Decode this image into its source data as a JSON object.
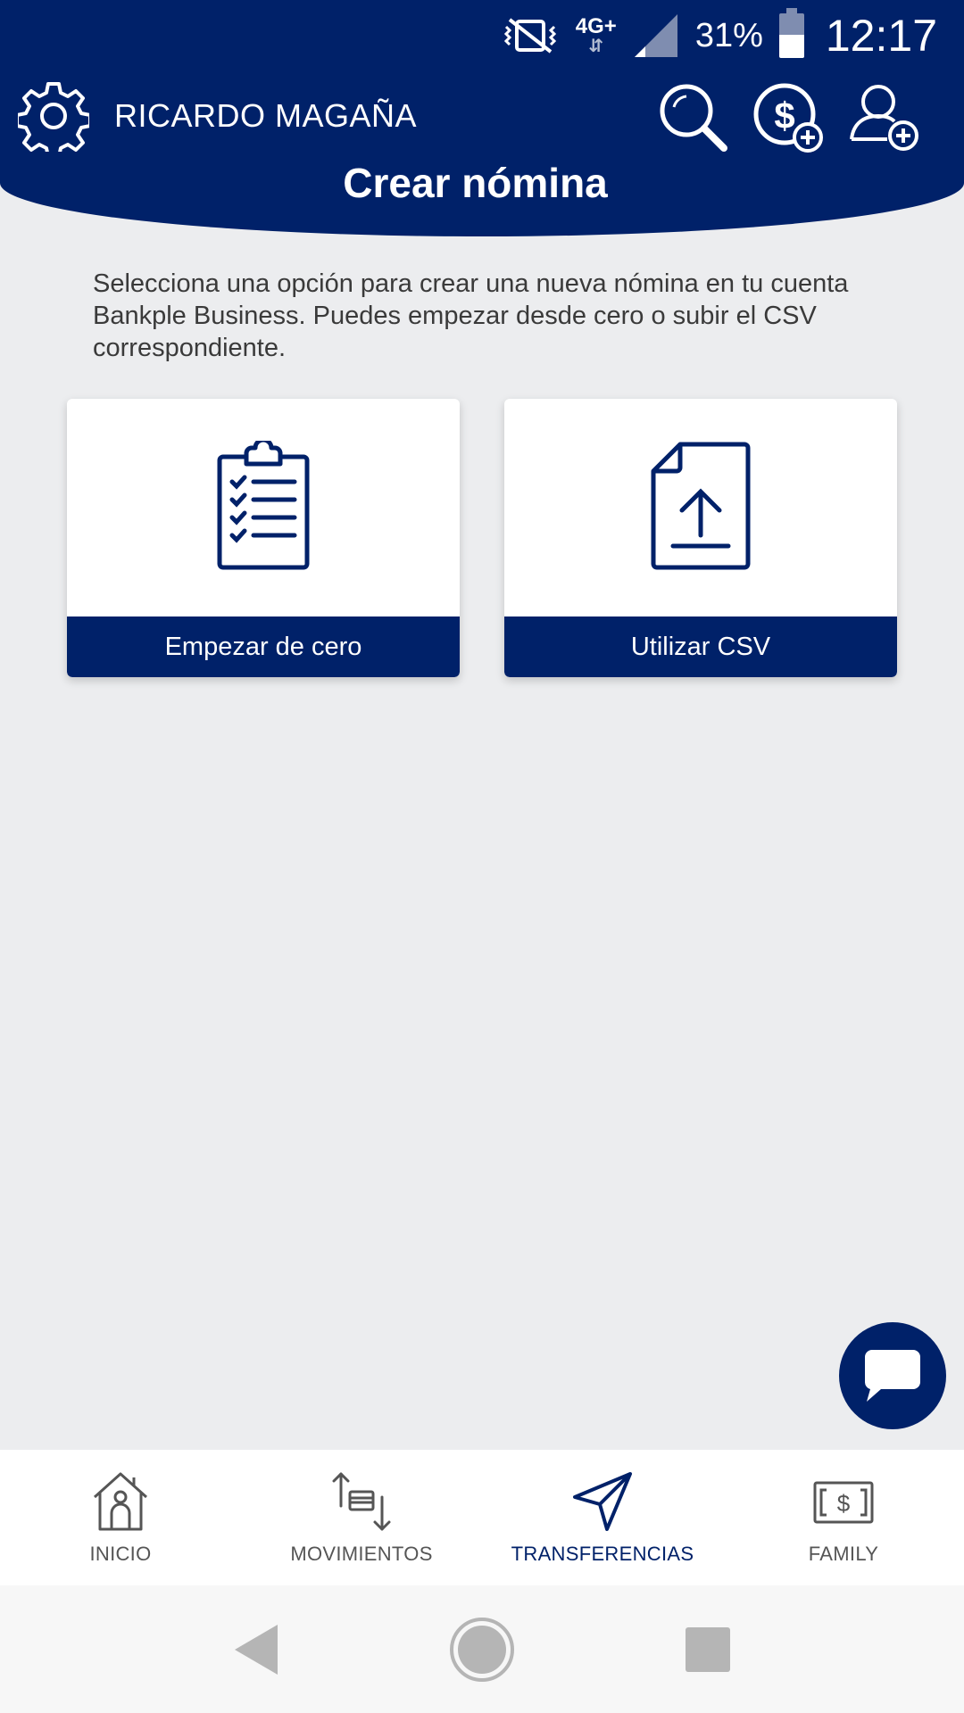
{
  "status_bar": {
    "network": "4G+",
    "battery": "31%",
    "time": "12:17",
    "icons": [
      "vibrate-off-icon",
      "data-arrows-icon",
      "signal-icon",
      "battery-icon"
    ]
  },
  "header": {
    "user_name": "RICARDO MAGAÑA",
    "title": "Crear nómina",
    "background_color": "#002169",
    "icons": [
      "gear-icon",
      "search-icon",
      "add-money-icon",
      "add-user-icon"
    ]
  },
  "main": {
    "intro_text": "Selecciona una opción para crear una nueva nómina en tu cuenta Bankple Business. Puedes empezar desde cero o subir el CSV correspondiente.",
    "options": [
      {
        "label": "Empezar de cero",
        "icon": "clipboard-checklist-icon"
      },
      {
        "label": "Utilizar CSV",
        "icon": "file-upload-icon"
      }
    ]
  },
  "chat": {
    "icon": "chat-bubble-icon"
  },
  "bottom_nav": {
    "items": [
      {
        "label": "INICIO",
        "icon": "home-icon",
        "active": false
      },
      {
        "label": "MOVIMIENTOS",
        "icon": "transactions-icon",
        "active": false
      },
      {
        "label": "TRANSFERENCIAS",
        "icon": "paper-plane-icon",
        "active": true
      },
      {
        "label": "FAMILY",
        "icon": "money-bill-icon",
        "active": false
      }
    ],
    "active_color": "#002169"
  },
  "android_nav": {
    "icons": [
      "back-icon",
      "home-circle-icon",
      "recents-icon"
    ]
  }
}
